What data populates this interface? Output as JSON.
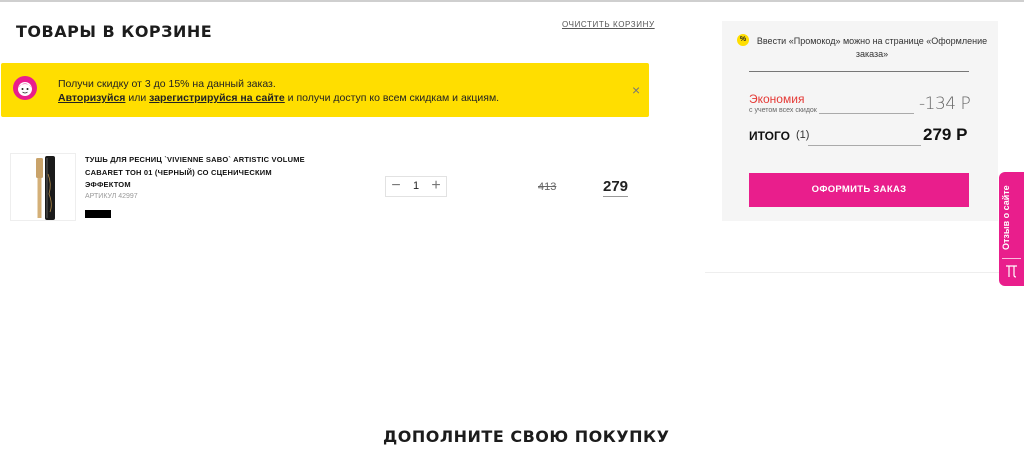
{
  "cart": {
    "title": "ТОВАРЫ В КОРЗИНЕ",
    "clear_label": "очистить корзину"
  },
  "promo": {
    "line1": "Получи скидку от 3 до 15% на данный заказ.",
    "login_link": "Авторизуйся",
    "or_text": " или ",
    "register_link": "зарегистрируйся на сайте",
    "tail_text": " и получи доступ ко всем скидкам и акциям.",
    "close_label": "×"
  },
  "item": {
    "name": "ТУШЬ ДЛЯ РЕСНИЦ `VIVIENNE SABO` ARTISTIC VOLUME CABARET ТОН 01 (ЧЕРНЫЙ) СО СЦЕНИЧЕСКИМ ЭФФЕКТОМ",
    "sku": "АРТИКУЛ 42997",
    "qty_minus": "−",
    "qty_plus": "+",
    "quantity": "1",
    "old_price": "413",
    "price": "279"
  },
  "summary": {
    "promo_icon": "%",
    "promo_hint": "Ввести «Промокод» можно на странице «Оформление заказа»",
    "economy_label": "Экономия",
    "economy_note": "с учетом всех скидок",
    "economy_value": "-134 Р",
    "total_label": "ИТОГО",
    "total_count": "(1)",
    "total_value": "279 Р",
    "checkout_label": "ОФОРМИТЬ ЗАКАЗ"
  },
  "feedback": {
    "label": "Отзыв о сайте",
    "logo_glyph": "Л"
  },
  "recommend": {
    "title": "ДОПОЛНИТЕ СВОЮ ПОКУПКУ"
  },
  "colors": {
    "accent": "#e91e8c",
    "banner": "#ffde00",
    "economy": "#e53935"
  },
  "icons": {
    "promo_face": "face-icon",
    "close": "close-icon",
    "brand": "brand-logo-icon"
  }
}
